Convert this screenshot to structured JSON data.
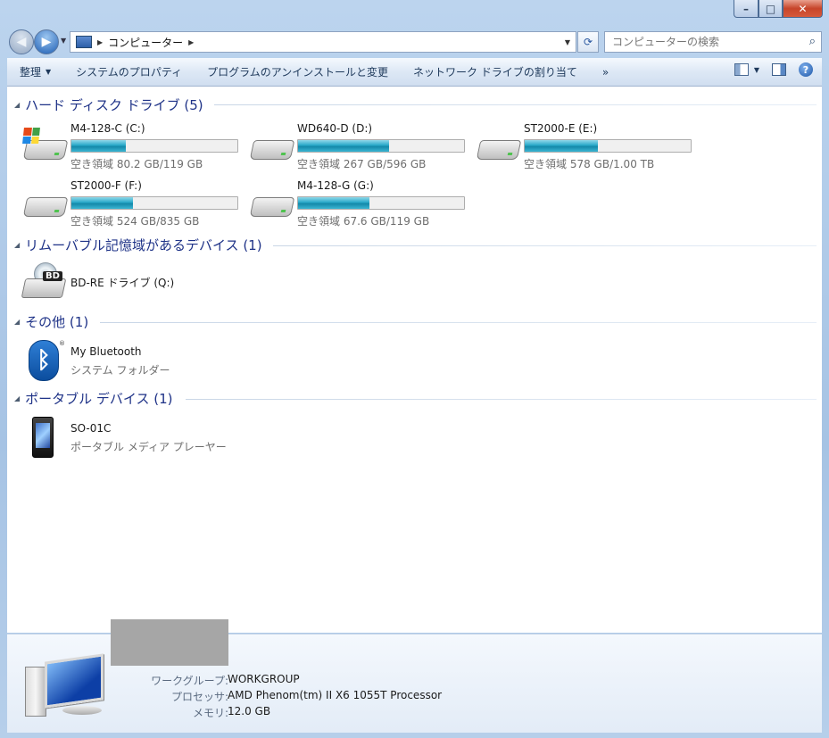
{
  "window": {
    "buttons": {
      "minimize": "–",
      "maximize": "□",
      "close": "✕"
    }
  },
  "nav": {
    "address_segments": [
      "コンピューター"
    ],
    "search_placeholder": "コンピューターの検索"
  },
  "toolbar": {
    "organize": "整理",
    "items": [
      "システムのプロパティ",
      "プログラムのアンインストールと変更",
      "ネットワーク ドライブの割り当て"
    ],
    "more": "»"
  },
  "groups": {
    "hdd": {
      "title": "ハード ディスク ドライブ (5)",
      "drives": [
        {
          "name": "M4-128-C (C:)",
          "free_text": "空き領域 80.2 GB/119 GB",
          "used_fraction": 0.33,
          "system": true
        },
        {
          "name": "WD640-D (D:)",
          "free_text": "空き領域 267 GB/596 GB",
          "used_fraction": 0.55,
          "system": false
        },
        {
          "name": "ST2000-E (E:)",
          "free_text": "空き領域 578 GB/1.00 TB",
          "used_fraction": 0.44,
          "system": false
        },
        {
          "name": "ST2000-F (F:)",
          "free_text": "空き領域 524 GB/835 GB",
          "used_fraction": 0.37,
          "system": false
        },
        {
          "name": "M4-128-G (G:)",
          "free_text": "空き領域 67.6 GB/119 GB",
          "used_fraction": 0.43,
          "system": false
        }
      ]
    },
    "removable": {
      "title": "リムーバブル記憶域があるデバイス (1)",
      "items": [
        {
          "name": "BD-RE ドライブ (Q:)",
          "badge": "BD"
        }
      ]
    },
    "other": {
      "title": "その他 (1)",
      "items": [
        {
          "name": "My Bluetooth",
          "sub": "システム フォルダー",
          "reg": "®"
        }
      ]
    },
    "portable": {
      "title": "ポータブル デバイス (1)",
      "items": [
        {
          "name": "SO-01C",
          "sub": "ポータブル メディア プレーヤー"
        }
      ]
    }
  },
  "details": {
    "rows": [
      {
        "key": "ワークグループ:",
        "value": "WORKGROUP"
      },
      {
        "key": "プロセッサ:",
        "value": "AMD Phenom(tm) II X6 1055T Processor"
      },
      {
        "key": "メモリ:",
        "value": "12.0 GB"
      }
    ]
  },
  "colors": {
    "accent": "#1e3287",
    "bar_fill": "#27a8c8"
  }
}
